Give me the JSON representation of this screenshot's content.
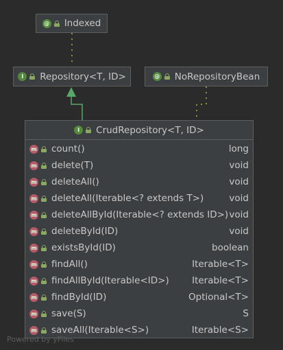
{
  "nodes": {
    "indexed": {
      "name": "Indexed",
      "kind": "annotation",
      "badge": "@"
    },
    "repository": {
      "name": "Repository<T, ID>",
      "kind": "interface",
      "badge": "I"
    },
    "norepositorybean": {
      "name": "NoRepositoryBean",
      "kind": "annotation",
      "badge": "@"
    },
    "crudrepository": {
      "name": "CrudRepository<T, ID>",
      "kind": "interface",
      "badge": "I"
    }
  },
  "methods": [
    {
      "name": "count()",
      "returns": "long"
    },
    {
      "name": "delete(T)",
      "returns": "void"
    },
    {
      "name": "deleteAll()",
      "returns": "void"
    },
    {
      "name": "deleteAll(Iterable<? extends T>)",
      "returns": "void"
    },
    {
      "name": "deleteAllById(Iterable<? extends ID>)",
      "returns": "void"
    },
    {
      "name": "deleteById(ID)",
      "returns": "void"
    },
    {
      "name": "existsById(ID)",
      "returns": "boolean"
    },
    {
      "name": "findAll()",
      "returns": "Iterable<T>"
    },
    {
      "name": "findAllById(Iterable<ID>)",
      "returns": "Iterable<T>"
    },
    {
      "name": "findById(ID)",
      "returns": "Optional<T>"
    },
    {
      "name": "save(S)",
      "returns": "S"
    },
    {
      "name": "saveAll(Iterable<S>)",
      "returns": "Iterable<S>"
    }
  ],
  "method_badge": "m",
  "footer": "Powered by yFiles",
  "colors": {
    "background": "#2b2b2b",
    "node": "#3c3f41",
    "annotation_edge": "#7f9a3a",
    "inheritance_edge": "#59a869",
    "method_badge": "#b55a69"
  }
}
